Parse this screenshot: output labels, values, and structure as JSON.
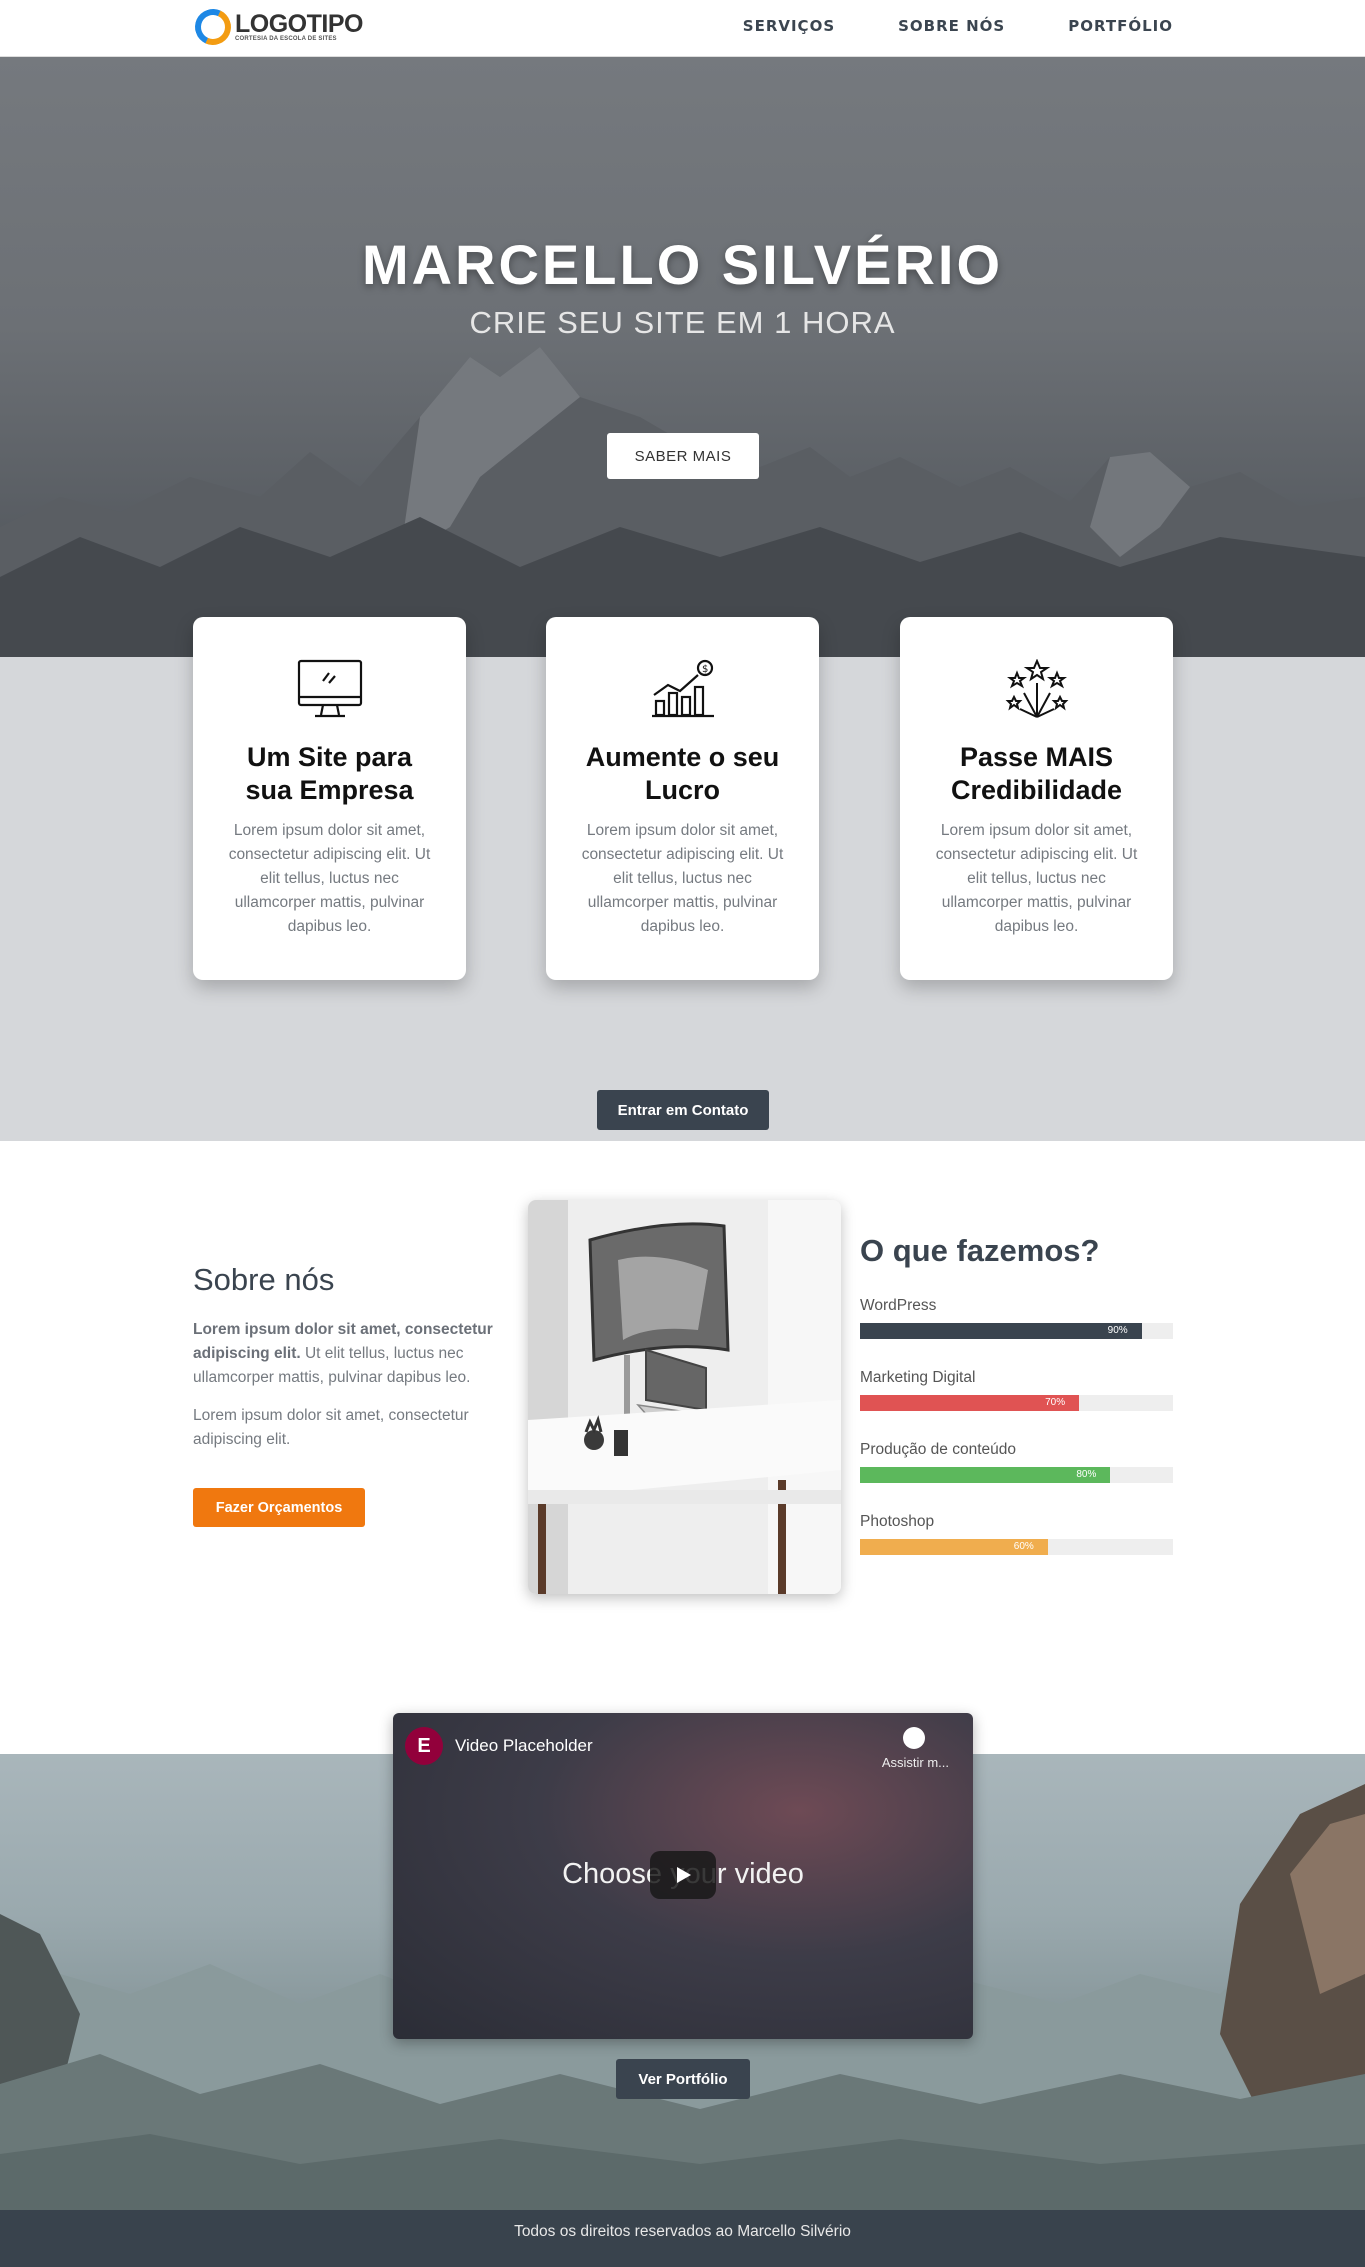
{
  "header": {
    "logo_text": "LOGOTIPO",
    "logo_sub": "CORTESIA DA ESCOLA DE SITES",
    "nav": [
      "SERVIÇOS",
      "SOBRE NÓS",
      "PORTFÓLIO"
    ]
  },
  "hero": {
    "title": "MARCELLO SILVÉRIO",
    "subtitle": "CRIE SEU SITE EM 1 HORA",
    "cta": "SABER MAIS"
  },
  "cards": [
    {
      "icon": "monitor-icon",
      "title_line1": "Um Site para",
      "title_line2": "sua Empresa",
      "text": "Lorem ipsum dolor sit amet, consectetur adipiscing elit. Ut elit tellus, luctus nec ullamcorper mattis, pulvinar dapibus leo."
    },
    {
      "icon": "growth-chart-icon",
      "title_line1": "Aumente o seu",
      "title_line2": "Lucro",
      "text": "Lorem ipsum dolor sit amet, consectetur adipiscing elit. Ut elit tellus, luctus nec ullamcorper mattis, pulvinar dapibus leo."
    },
    {
      "icon": "fireworks-icon",
      "title_line1": "Passe MAIS",
      "title_line2": "Credibilidade",
      "text": "Lorem ipsum dolor sit amet, consectetur adipiscing elit. Ut elit tellus, luctus nec ullamcorper mattis, pulvinar dapibus leo."
    }
  ],
  "contact_button": "Entrar em Contato",
  "about": {
    "title": "Sobre nós",
    "p1_bold": "Lorem ipsum dolor sit amet, consectetur adipiscing elit.",
    "p1_rest": " Ut elit tellus, luctus nec ullamcorper mattis, pulvinar dapibus leo.",
    "p2": "Lorem ipsum dolor sit amet, consectetur adipiscing elit.",
    "button": "Fazer Orçamentos"
  },
  "skills": {
    "title": "O que fazemos?",
    "items": [
      {
        "label": "WordPress",
        "percent": 90,
        "pct_text": "90%",
        "color": "#3a444f"
      },
      {
        "label": "Marketing Digital",
        "percent": 70,
        "pct_text": "70%",
        "color": "#e05353"
      },
      {
        "label": "Produção de conteúdo",
        "percent": 80,
        "pct_text": "80%",
        "color": "#5cb85c"
      },
      {
        "label": "Photoshop",
        "percent": 60,
        "pct_text": "60%",
        "color": "#f0ad4e"
      }
    ]
  },
  "video": {
    "title": "Video Placeholder",
    "watch_later": "Assistir m...",
    "big_text": "Choose your video"
  },
  "portfolio_button": "Ver Portfólio",
  "footer": "Todos os direitos reservados ao Marcello Silvério"
}
